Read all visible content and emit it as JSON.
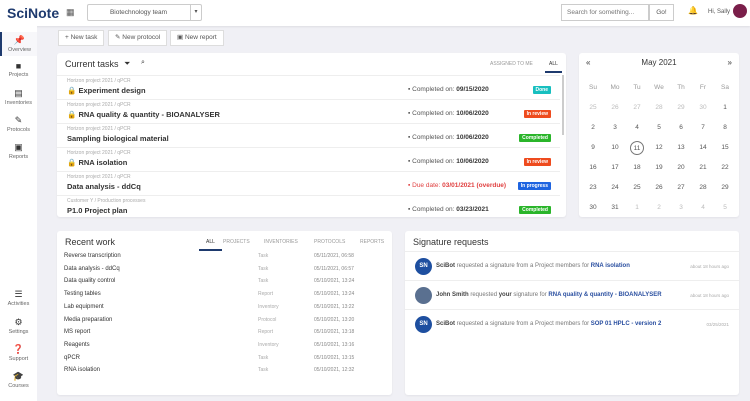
{
  "header": {
    "logo": "SciNote",
    "team": "Biotechnology team",
    "search_placeholder": "Search for something...",
    "go": "Go!",
    "greeting": "Hi, Sally"
  },
  "sidebar": {
    "top": [
      {
        "label": "Overview",
        "icon": "pin-icon"
      },
      {
        "label": "Projects",
        "icon": "folder-icon"
      },
      {
        "label": "Inventories",
        "icon": "table-icon"
      },
      {
        "label": "Protocols",
        "icon": "edit-icon"
      },
      {
        "label": "Reports",
        "icon": "clipboard-icon"
      }
    ],
    "bottom": [
      {
        "label": "Activities",
        "icon": "list-icon"
      },
      {
        "label": "Settings",
        "icon": "gear-icon"
      },
      {
        "label": "Support",
        "icon": "help-icon"
      },
      {
        "label": "Courses",
        "icon": "graduation-icon"
      }
    ]
  },
  "actions": {
    "new_task": "New task",
    "new_protocol": "New protocol",
    "new_report": "New report"
  },
  "current_tasks": {
    "title": "Current tasks",
    "tabs": [
      "ASSIGNED TO ME",
      "ALL"
    ],
    "items": [
      {
        "path": "Horizon project 2021  /  qPCR",
        "name": "Experiment design",
        "locked": true,
        "date_label": "Completed on:",
        "date": "09/15/2020",
        "status": "Done",
        "color": "#17bfbf"
      },
      {
        "path": "Horizon project 2021  /  qPCR",
        "name": "RNA quality & quantity - BIOANALYSER",
        "locked": true,
        "date_label": "Completed on:",
        "date": "10/06/2020",
        "status": "In review",
        "color": "#ee4b1e"
      },
      {
        "path": "Horizon project 2021  /  qPCR",
        "name": "Sampling biological material",
        "locked": false,
        "date_label": "Completed on:",
        "date": "10/06/2020",
        "status": "Completed",
        "color": "#2ab52a"
      },
      {
        "path": "Horizon project 2021  /  qPCR",
        "name": "RNA isolation",
        "locked": true,
        "date_label": "Completed on:",
        "date": "10/06/2020",
        "status": "In review",
        "color": "#ee4b1e"
      },
      {
        "path": "Horizon project 2021  /  qPCR",
        "name": "Data analysis - ddCq",
        "locked": false,
        "date_label": "Due date:",
        "date": "03/01/2021 (overdue)",
        "status": "In progress",
        "color": "#1e64e0",
        "overdue": true
      },
      {
        "path": "Customer Y  /  Production processes",
        "name": "P1.0 Project plan",
        "locked": false,
        "date_label": "Completed on:",
        "date": "03/23/2021",
        "status": "Completed",
        "color": "#2ab52a"
      }
    ]
  },
  "calendar": {
    "prev": "«",
    "next": "»",
    "month": "May 2021",
    "weekdays": [
      "Su",
      "Mo",
      "Tu",
      "We",
      "Th",
      "Fr",
      "Sa"
    ],
    "days": [
      "25",
      "26",
      "27",
      "28",
      "29",
      "30",
      "1",
      "2",
      "3",
      "4",
      "5",
      "6",
      "7",
      "8",
      "9",
      "10",
      "11",
      "12",
      "13",
      "14",
      "15",
      "16",
      "17",
      "18",
      "19",
      "20",
      "21",
      "22",
      "23",
      "24",
      "25",
      "26",
      "27",
      "28",
      "29",
      "30",
      "31",
      "1",
      "2",
      "3",
      "4",
      "5"
    ],
    "today": "11"
  },
  "recent_work": {
    "title": "Recent work",
    "tabs": [
      "ALL",
      "PROJECTS",
      "INVENTORIES",
      "PROTOCOLS",
      "REPORTS"
    ],
    "items": [
      {
        "name": "Reverse transcription",
        "type": "Task",
        "date": "05/11/2021, 06:58"
      },
      {
        "name": "Data analysis - ddCq",
        "type": "Task",
        "date": "05/11/2021, 06:57"
      },
      {
        "name": "Data quality control",
        "type": "Task",
        "date": "05/10/2021, 13:24"
      },
      {
        "name": "Testing tables",
        "type": "Report",
        "date": "05/10/2021, 13:24"
      },
      {
        "name": "Lab equipment",
        "type": "Inventory",
        "date": "05/10/2021, 13:22"
      },
      {
        "name": "Media preparation",
        "type": "Protocol",
        "date": "05/10/2021, 13:20"
      },
      {
        "name": "MS report",
        "type": "Report",
        "date": "05/10/2021, 13:18"
      },
      {
        "name": "Reagents",
        "type": "Inventory",
        "date": "05/10/2021, 13:16"
      },
      {
        "name": "qPCR",
        "type": "Task",
        "date": "05/10/2021, 13:15"
      },
      {
        "name": "RNA isolation",
        "type": "Task",
        "date": "05/10/2021, 12:32"
      }
    ]
  },
  "signatures": {
    "title": "Signature requests",
    "items": [
      {
        "avatar": "SN",
        "who": "SciBot",
        "mid": " requested a signature from a Project members for ",
        "your": "",
        "link": "RNA isolation",
        "time": "about 18 hours ago"
      },
      {
        "avatar": "",
        "who": "John Smith",
        "mid": " requested ",
        "your": "your",
        "mid2": " signature for ",
        "link": "RNA quality & quantity - BIOANALYSER",
        "time": "about 18 hours ago"
      },
      {
        "avatar": "SN",
        "who": "SciBot",
        "mid": " requested a signature from a Project members for ",
        "your": "",
        "link": "SOP 01 HPLC - version 2",
        "time": "03/25/2021"
      }
    ]
  }
}
